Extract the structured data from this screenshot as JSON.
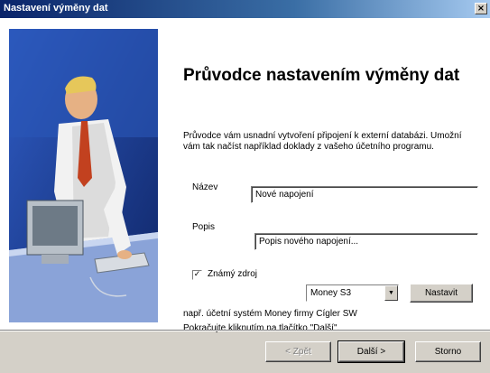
{
  "window": {
    "title": "Nastavení výměny dat",
    "close_glyph": "×"
  },
  "wizard": {
    "heading": "Průvodce nastavením výměny dat",
    "intro": "Průvodce vám usnadní vytvoření připojení k externí databázi. Umožní vám tak načíst například doklady z vašeho účetního programu."
  },
  "form": {
    "name_label": "Název",
    "name_value": "Nové napojení",
    "description_label": "Popis",
    "description_value": "Popis nového napojení...",
    "known_source_label": "Známý zdroj",
    "known_source_checked": true,
    "source_select_value": "Money S3",
    "settings_button": "Nastavit"
  },
  "hint": {
    "line1": "např. účetní systém Money firmy Cígler SW",
    "line2": "Pokračujte kliknutím na tlačítko \"Další\"."
  },
  "buttons": {
    "back": "< Zpět",
    "next": "Další >",
    "cancel": "Storno"
  },
  "colors": {
    "titlebar_start": "#0a246a",
    "titlebar_end": "#a6caf0",
    "dialog_face": "#d4d0c8",
    "illustration_bg": "#1e3a8c"
  }
}
